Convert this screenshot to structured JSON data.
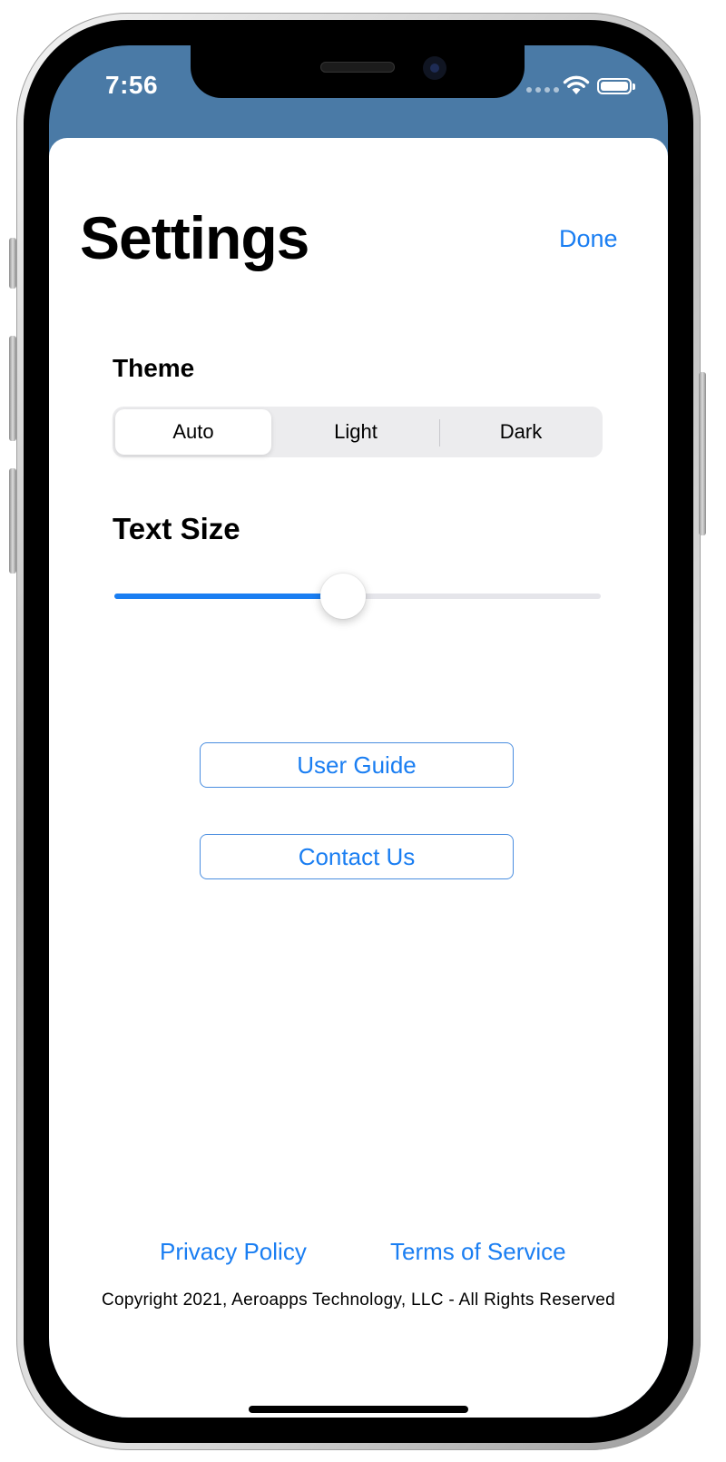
{
  "status_bar": {
    "time": "7:56"
  },
  "header": {
    "title": "Settings",
    "done_label": "Done"
  },
  "theme": {
    "label": "Theme",
    "options": [
      "Auto",
      "Light",
      "Dark"
    ],
    "selected": "Auto"
  },
  "text_size": {
    "label": "Text Size",
    "value": 0.47
  },
  "buttons": {
    "user_guide": "User Guide",
    "contact_us": "Contact Us"
  },
  "footer": {
    "privacy": "Privacy Policy",
    "terms": "Terms of Service",
    "copyright": "Copyright 2021, Aeroapps Technology, LLC - All Rights Reserved"
  },
  "colors": {
    "accent": "#1a7ef2",
    "status_bar_bg": "#4a7aa6"
  }
}
